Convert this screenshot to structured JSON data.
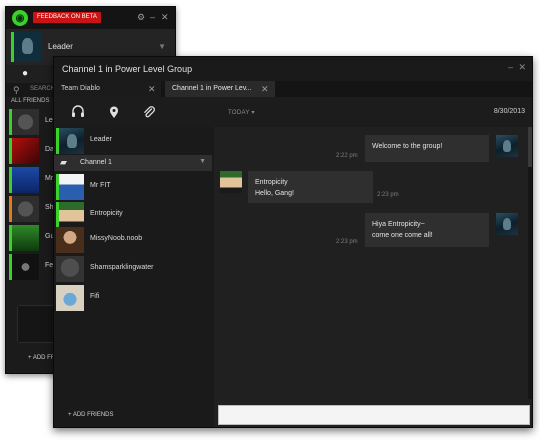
{
  "back_window": {
    "feedback_label": "FEEDBACK ON BETA",
    "settings_icon": "gear-icon",
    "minimize_icon": "minimize-icon",
    "close_icon": "close-icon",
    "user_name": "Leader",
    "search_placeholder": "SEARCH",
    "section_label": "ALL FRIENDS",
    "friends": [
      {
        "name": "Lea"
      },
      {
        "name": "Da"
      },
      {
        "name": "Mr"
      },
      {
        "name": "Sh"
      },
      {
        "name": "Gu"
      },
      {
        "name": "Fe"
      }
    ],
    "add_friends_label": "+ ADD FRIE"
  },
  "main_window": {
    "title": "Channel 1 in Power Level Group",
    "tabs": [
      {
        "label": "Team Diablo"
      },
      {
        "label": "Channel 1 in Power Lev..."
      }
    ],
    "toolbar": {
      "icons": [
        "headset-icon",
        "location-pin-icon",
        "paperclip-icon"
      ],
      "today_label": "TODAY",
      "date": "8/30/2013"
    },
    "roster": {
      "owner": "Leader",
      "channel_name": "Channel 1",
      "members": [
        {
          "name": "Mr FIT"
        },
        {
          "name": "Entropicity"
        },
        {
          "name": "MissyNoob.noob"
        },
        {
          "name": "Shamsparklingwater"
        },
        {
          "name": "Fifi"
        }
      ],
      "add_friends_label": "+ ADD FRIENDS"
    },
    "messages": [
      {
        "time": "2:22 pm",
        "lines": [
          "Welcome to the group!"
        ]
      },
      {
        "time": "2:23 pm",
        "lines": [
          "Entropicity",
          "Hello, Gang!"
        ]
      },
      {
        "time": "2:23 pm",
        "lines": [
          "Hiya Entropicity~",
          "come one come all!"
        ]
      }
    ],
    "input_value": ""
  },
  "colors": {
    "accent_green": "#39d12a",
    "beta_red": "#c81414"
  }
}
